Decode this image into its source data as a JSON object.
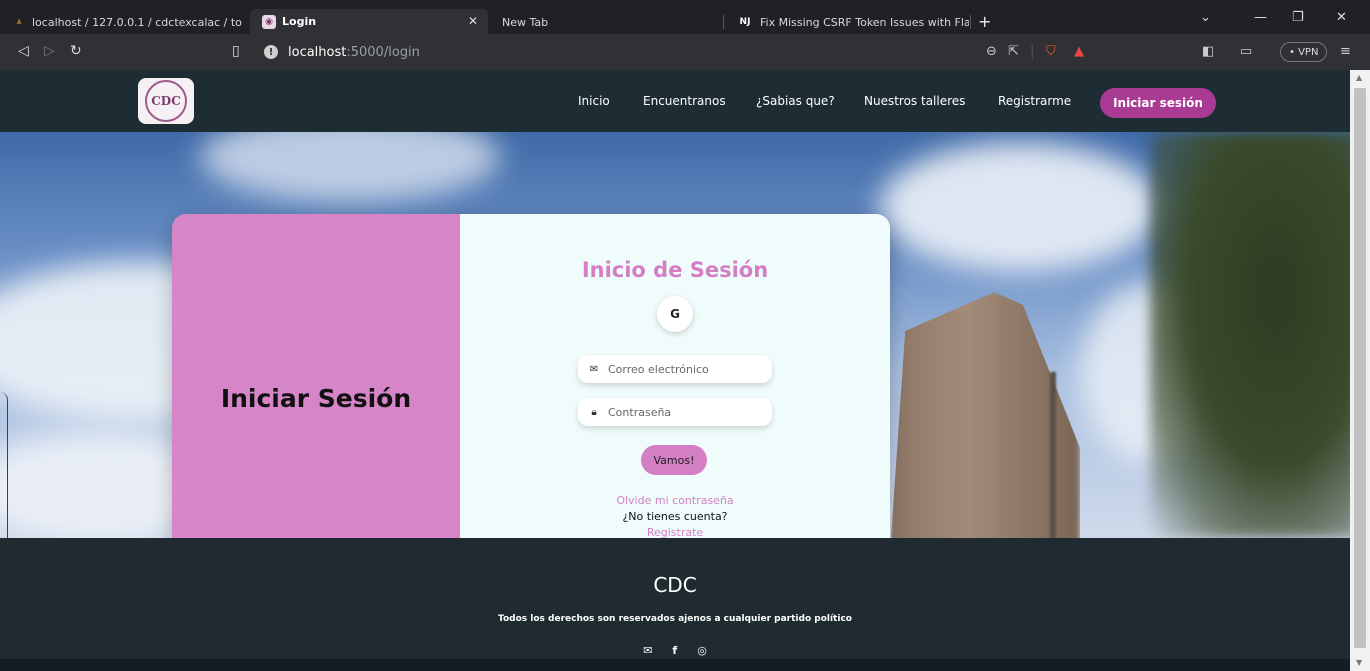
{
  "browser": {
    "tabs": [
      {
        "title": "localhost / 127.0.0.1 / cdctexcalac / to",
        "favicon": "phpmyadmin-icon",
        "active": false
      },
      {
        "title": "Login",
        "favicon": "site-favicon",
        "active": true
      },
      {
        "title": "New Tab",
        "favicon": "",
        "active": false
      },
      {
        "title": "Fix Missing CSRF Token Issues with Fla",
        "favicon": "NJ",
        "active": false
      }
    ],
    "url_host": "localhost",
    "url_path": ":5000/login",
    "vpn_label": "• VPN"
  },
  "nav": {
    "logo_text": "CDC",
    "links": [
      "Inicio",
      "Encuentranos",
      "¿Sabias que?",
      "Nuestros talleres",
      "Registrarme"
    ],
    "cta": "Iniciar sesión"
  },
  "login": {
    "side_heading": "Iniciar Sesión",
    "title": "Inicio de Sesión",
    "google_label": "G",
    "email_placeholder": "Correo electrónico",
    "password_placeholder": "Contraseña",
    "submit_label": "Vamos!",
    "forgot_link": "Olvide mi contraseña",
    "no_account": "¿No tienes cuenta?",
    "register_link": "Registrate"
  },
  "footer": {
    "brand": "CDC",
    "rights": "Todos los derechos son reservados ajenos a cualquier partido político",
    "icons": [
      "mail-icon",
      "facebook-icon",
      "instagram-icon"
    ]
  },
  "colors": {
    "nav_bg": "#1e2d33",
    "accent_pink": "#d47fc4",
    "cta_purple": "#a93b95",
    "left_panel": "#d585c8",
    "form_bg": "#f0fcfb"
  }
}
